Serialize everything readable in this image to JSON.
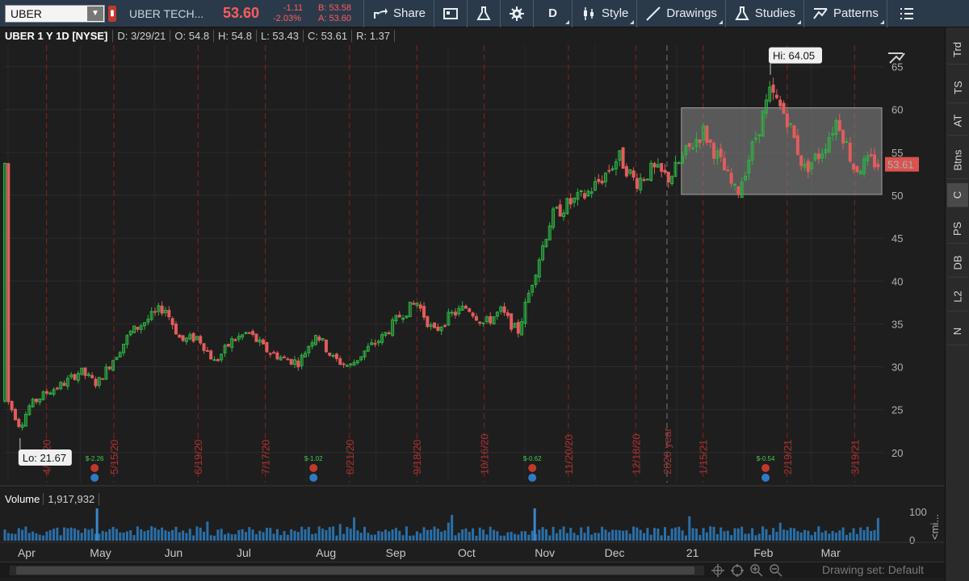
{
  "toolbar": {
    "symbol": "UBER",
    "company": "UBER TECH...",
    "last_price": "53.60",
    "change": "-1.11",
    "change_pct": "-2.03%",
    "bid": "B: 53.58",
    "ask": "A: 53.60",
    "share_label": "Share",
    "timeframe": "D",
    "style_label": "Style",
    "drawings_label": "Drawings",
    "studies_label": "Studies",
    "patterns_label": "Patterns"
  },
  "header": {
    "title": "UBER 1 Y 1D [NYSE]",
    "date": "D: 3/29/21",
    "open": "O: 54.8",
    "high": "H: 54.8",
    "low": "L: 53.43",
    "close": "C: 53.61",
    "range": "R: 1.37"
  },
  "sidebar": {
    "tabs": [
      "Trd",
      "TS",
      "AT",
      "Btns",
      "C",
      "PS",
      "DB",
      "L2",
      "N"
    ],
    "active": "C"
  },
  "chart_data": {
    "type": "candlestick",
    "symbol": "UBER",
    "price_axis": {
      "ticks": [
        20,
        25,
        30,
        35,
        40,
        45,
        50,
        55,
        60,
        65
      ],
      "min": 16.5,
      "max": 67.5
    },
    "current_price_label": "53.61",
    "hi_label": "Hi: 64.05",
    "lo_label": "Lo: 21.67",
    "month_labels": [
      "Apr",
      "May",
      "Jun",
      "Jul",
      "Aug",
      "Sep",
      "Oct",
      "Nov",
      "Dec",
      "21",
      "Feb",
      "Mar"
    ],
    "expiration_labels": [
      "4/17/20",
      "5/15/20",
      "6/19/20",
      "7/17/20",
      "8/21/20",
      "9/18/20",
      "10/16/20",
      "11/20/20",
      "12/18/20",
      "2020 year",
      "1/15/21",
      "2/19/21",
      "3/19/21"
    ],
    "earnings_labels": [
      "$-2.26",
      "$-1.02",
      "$-0.62",
      "$-0.54"
    ],
    "range_box": {
      "top": 60.2,
      "bottom": 50.1
    },
    "trend": [
      {
        "t": "4/1/20",
        "p": 26
      },
      {
        "t": "4/6/20",
        "p": 23
      },
      {
        "t": "4/10/20",
        "p": 25.5
      },
      {
        "t": "4/17/20",
        "p": 27
      },
      {
        "t": "4/24/20",
        "p": 28
      },
      {
        "t": "5/1/20",
        "p": 29.5
      },
      {
        "t": "5/8/20",
        "p": 28
      },
      {
        "t": "5/15/20",
        "p": 31
      },
      {
        "t": "5/22/20",
        "p": 34
      },
      {
        "t": "5/29/20",
        "p": 35.5
      },
      {
        "t": "6/5/20",
        "p": 37
      },
      {
        "t": "6/12/20",
        "p": 33
      },
      {
        "t": "6/19/20",
        "p": 33.5
      },
      {
        "t": "6/26/20",
        "p": 30.5
      },
      {
        "t": "7/3/20",
        "p": 33
      },
      {
        "t": "7/10/20",
        "p": 34
      },
      {
        "t": "7/17/20",
        "p": 32
      },
      {
        "t": "7/24/20",
        "p": 31
      },
      {
        "t": "7/31/20",
        "p": 30.5
      },
      {
        "t": "8/7/20",
        "p": 34
      },
      {
        "t": "8/14/20",
        "p": 31
      },
      {
        "t": "8/21/20",
        "p": 30
      },
      {
        "t": "8/28/20",
        "p": 32
      },
      {
        "t": "9/4/20",
        "p": 33.5
      },
      {
        "t": "9/11/20",
        "p": 36
      },
      {
        "t": "9/18/20",
        "p": 37.5
      },
      {
        "t": "9/25/20",
        "p": 34
      },
      {
        "t": "10/2/20",
        "p": 36
      },
      {
        "t": "10/9/20",
        "p": 37
      },
      {
        "t": "10/16/20",
        "p": 35
      },
      {
        "t": "10/23/20",
        "p": 36.5
      },
      {
        "t": "10/30/20",
        "p": 34
      },
      {
        "t": "11/6/20",
        "p": 41
      },
      {
        "t": "11/13/20",
        "p": 47.5
      },
      {
        "t": "11/20/20",
        "p": 49
      },
      {
        "t": "11/27/20",
        "p": 50
      },
      {
        "t": "12/4/20",
        "p": 52
      },
      {
        "t": "12/11/20",
        "p": 54.5
      },
      {
        "t": "12/18/20",
        "p": 51.5
      },
      {
        "t": "12/25/20",
        "p": 53
      },
      {
        "t": "1/1/21",
        "p": 52
      },
      {
        "t": "1/8/21",
        "p": 55
      },
      {
        "t": "1/15/21",
        "p": 57.5
      },
      {
        "t": "1/22/21",
        "p": 54
      },
      {
        "t": "1/29/21",
        "p": 50
      },
      {
        "t": "2/5/21",
        "p": 56
      },
      {
        "t": "2/12/21",
        "p": 62
      },
      {
        "t": "2/19/21",
        "p": 59
      },
      {
        "t": "2/26/21",
        "p": 53
      },
      {
        "t": "3/5/21",
        "p": 55
      },
      {
        "t": "3/12/21",
        "p": 59
      },
      {
        "t": "3/19/21",
        "p": 53
      },
      {
        "t": "3/26/21",
        "p": 54
      },
      {
        "t": "3/29/21",
        "p": 53.61
      }
    ]
  },
  "volume": {
    "label": "Volume",
    "value": "1,917,932",
    "axis_max": "100",
    "axis_min": "0",
    "side_label": "<mi..."
  },
  "bottom": {
    "drawing_set": "Drawing set: Default"
  },
  "colors": {
    "up": "#2fb344",
    "down": "#e25c5c",
    "volume": "#2a6fa8",
    "expiry_line": "#8b1f1f",
    "range_box": "#8a8a8a"
  }
}
